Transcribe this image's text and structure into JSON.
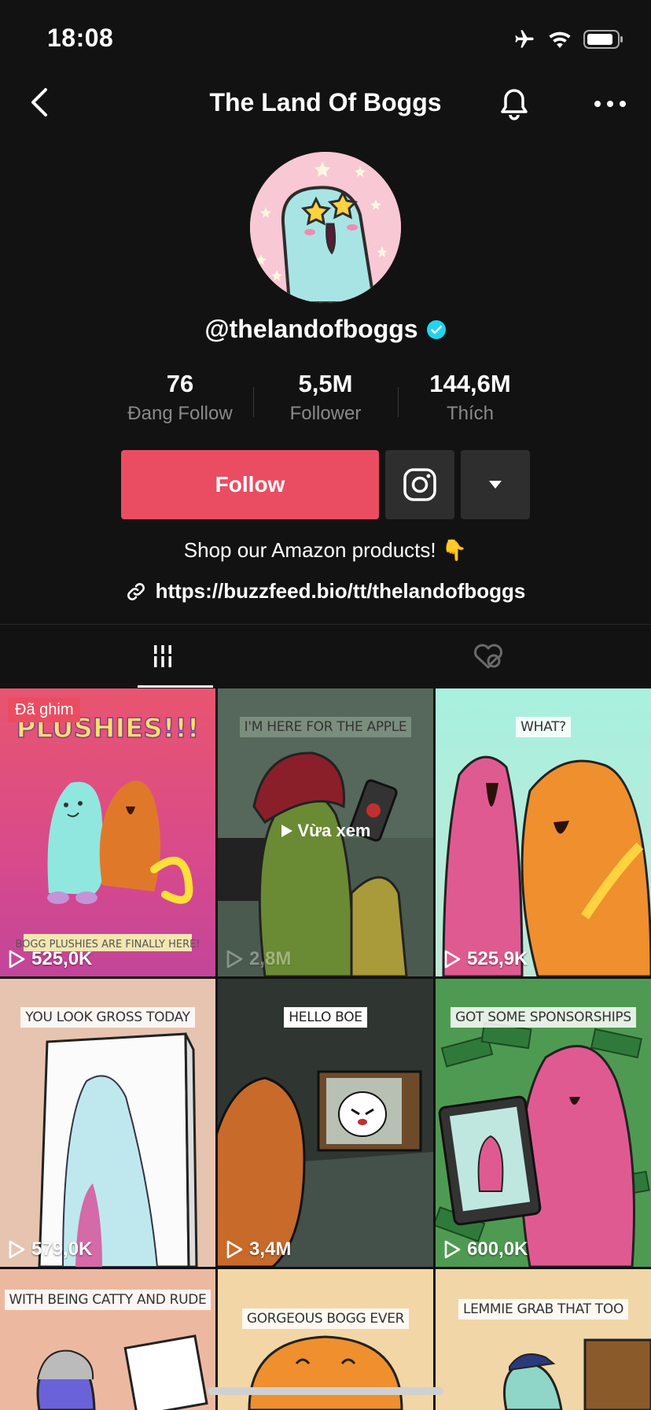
{
  "status_bar": {
    "time": "18:08"
  },
  "header": {
    "title": "The Land Of Boggs"
  },
  "profile": {
    "username": "@thelandofboggs",
    "bio": "Shop our Amazon products! 👇",
    "link": "https://buzzfeed.bio/tt/thelandofboggs"
  },
  "stats": [
    {
      "value": "76",
      "label": "Đang Follow"
    },
    {
      "value": "5,5M",
      "label": "Follower"
    },
    {
      "value": "144,6M",
      "label": "Thích"
    }
  ],
  "actions": {
    "follow_label": "Follow"
  },
  "grid": {
    "pinned_label": "Đã ghim",
    "watched_label": "Vừa xem",
    "videos": [
      {
        "caption_top": "PLUSHIES!!!",
        "caption_bottom": "BOGG PLUSHIES ARE FINALLY HERE!",
        "views": "525,0K"
      },
      {
        "caption_top": "I'M HERE FOR THE APPLE",
        "views": "2,8M"
      },
      {
        "caption_top": "WHAT?",
        "views": "525,9K"
      },
      {
        "caption_top": "YOU LOOK GROSS TODAY",
        "views": "579,0K"
      },
      {
        "caption_top": "HELLO BOE",
        "views": "3,4M"
      },
      {
        "caption_top": "GOT SOME SPONSORSHIPS",
        "views": "600,0K"
      },
      {
        "caption_top": "WITH BEING CATTY AND RUDE"
      },
      {
        "caption_top": "GORGEOUS BOGG EVER"
      },
      {
        "caption_top": "LEMMIE GRAB THAT TOO"
      }
    ]
  },
  "colors": {
    "accent": "#ea4d61",
    "background": "#121212",
    "verified": "#20d5ec"
  }
}
